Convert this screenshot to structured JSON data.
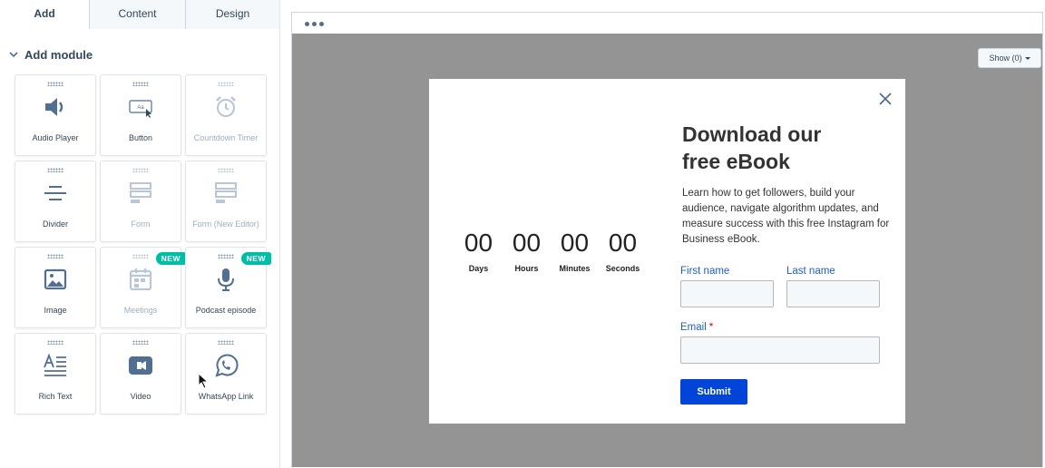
{
  "sidebar": {
    "tabs": [
      {
        "label": "Add",
        "active": true
      },
      {
        "label": "Content",
        "active": false
      },
      {
        "label": "Design",
        "active": false
      }
    ],
    "section_title": "Add module",
    "modules": [
      {
        "label": "Audio Player",
        "icon": "speaker-icon",
        "disabled": false
      },
      {
        "label": "Button",
        "icon": "button-icon",
        "disabled": false
      },
      {
        "label": "Countdown Timer",
        "icon": "alarm-clock-icon",
        "disabled": true
      },
      {
        "label": "Divider",
        "icon": "divider-icon",
        "disabled": false
      },
      {
        "label": "Form",
        "icon": "form-icon",
        "disabled": true
      },
      {
        "label": "Form (New Editor)",
        "icon": "form-icon",
        "disabled": true
      },
      {
        "label": "Image",
        "icon": "image-icon",
        "disabled": false
      },
      {
        "label": "Meetings",
        "icon": "calendar-icon",
        "disabled": true,
        "badge": "NEW"
      },
      {
        "label": "Podcast episode",
        "icon": "microphone-icon",
        "disabled": false,
        "badge": "NEW"
      },
      {
        "label": "Rich Text",
        "icon": "rich-text-icon",
        "disabled": false
      },
      {
        "label": "Video",
        "icon": "video-camera-icon",
        "disabled": false
      },
      {
        "label": "WhatsApp Link",
        "icon": "whatsapp-icon",
        "disabled": false
      }
    ]
  },
  "preview": {
    "show_button": "Show (0)",
    "popup": {
      "countdown": [
        {
          "value": "00",
          "label": "Days"
        },
        {
          "value": "00",
          "label": "Hours"
        },
        {
          "value": "00",
          "label": "Minutes"
        },
        {
          "value": "00",
          "label": "Seconds"
        }
      ],
      "headline_line1": "Download our",
      "headline_line2": "free eBook",
      "description": "Learn how to get followers, build your audience, navigate algorithm updates, and measure success with this free Instagram for Business eBook.",
      "first_name_label": "First name",
      "last_name_label": "Last name",
      "email_label": "Email",
      "required_mark": "*",
      "submit_label": "Submit"
    }
  },
  "colors": {
    "accent_teal": "#00bda5",
    "submit_blue": "#0045d8",
    "label_blue": "#1f5fc1",
    "stage_gray": "#949494"
  }
}
